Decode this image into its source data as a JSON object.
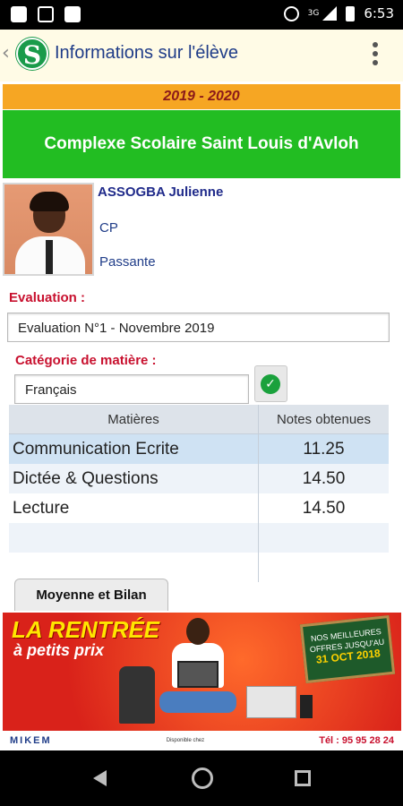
{
  "status_bar": {
    "time": "6:53",
    "network": "3G",
    "left_icons": [
      "notification-list-icon",
      "gmail-icon",
      "image-icon"
    ],
    "right_icons": [
      "alarm-icon",
      "signal-icon",
      "battery-icon"
    ]
  },
  "app_bar": {
    "title": "Informations sur l'élève",
    "logo_letter": "S",
    "back_glyph": "‹"
  },
  "school_year": "2019 - 2020",
  "school_name": "Complexe Scolaire Saint Louis d'Avloh",
  "student": {
    "name": "ASSOGBA Julienne",
    "class": "CP",
    "status": "Passante"
  },
  "evaluation": {
    "label": "Evaluation :",
    "selected": "Evaluation N°1 - Novembre 2019"
  },
  "category": {
    "label": "Catégorie de matière :",
    "selected": "Français",
    "confirm_glyph": "✓"
  },
  "grades_table": {
    "headers": [
      "Matières",
      "Notes obtenues"
    ],
    "rows": [
      {
        "subject": "Communication Ecrite",
        "grade": "11.25"
      },
      {
        "subject": "Dictée & Questions",
        "grade": "14.50"
      },
      {
        "subject": "Lecture",
        "grade": "14.50"
      }
    ]
  },
  "tabs": {
    "summary": "Moyenne et Bilan"
  },
  "ad": {
    "headline": "LA RENTRÉE",
    "subheadline": "à petits prix",
    "board_line1": "NOS MEILLEURES",
    "board_line2": "OFFRES JUSQU'AU",
    "board_date": "31 OCT 2018",
    "brand": "MIKEM",
    "available": "Disponible chez",
    "phone": "Tél : 95 95 28 24"
  },
  "colors": {
    "year_band": "#f6a623",
    "school_band": "#22bd22",
    "title_blue": "#1f3c88",
    "label_red": "#c8102e",
    "selected_row": "#cfe2f3"
  }
}
